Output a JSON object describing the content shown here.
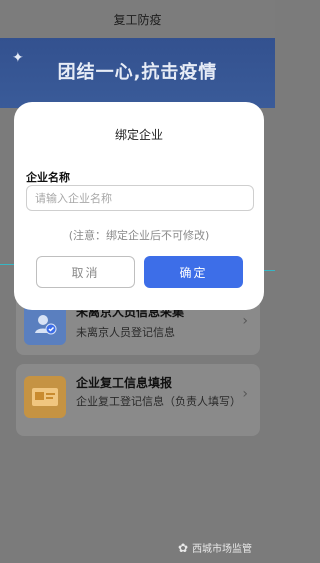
{
  "header": {
    "title": "复工防疫"
  },
  "banner": {
    "text": "团结一心,抗击疫情"
  },
  "cards": [
    {
      "title": "未离京人员信息采集",
      "desc": "未离京人员登记信息"
    },
    {
      "title": "企业复工信息填报",
      "desc": "企业复工登记信息（负责人填写）"
    }
  ],
  "modal": {
    "title": "绑定企业",
    "field_label": "企业名称",
    "field_placeholder": "请输入企业名称",
    "note": "(注意：绑定企业后不可修改)",
    "cancel_label": "取消",
    "confirm_label": "确定"
  },
  "watermark": {
    "text": "西城市场监管"
  },
  "colors": {
    "primary": "#3d6ee8",
    "banner": "#3a5b99"
  }
}
